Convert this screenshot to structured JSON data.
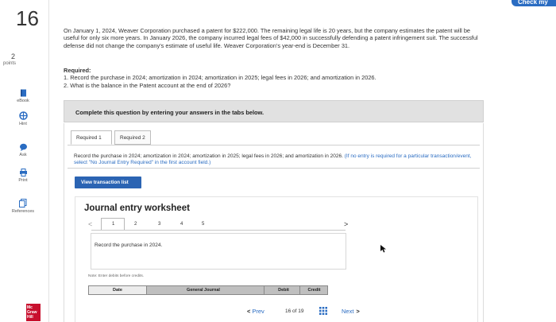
{
  "header": {
    "check_label": "Check my"
  },
  "question": {
    "number": "16",
    "points_value": "2",
    "points_label": "points"
  },
  "tools": [
    {
      "label": "eBook",
      "icon": "book-icon"
    },
    {
      "label": "Hint",
      "icon": "hint-icon"
    },
    {
      "label": "Ask",
      "icon": "ask-icon"
    },
    {
      "label": "Print",
      "icon": "print-icon"
    },
    {
      "label": "References",
      "icon": "references-icon"
    }
  ],
  "publisher_logo": "Mc Graw Hill",
  "problem": {
    "text": "On January 1, 2024, Weaver Corporation purchased a patent for $222,000. The remaining legal life is 20 years, but the company estimates the patent will be useful for only six more years. In January 2026, the company incurred legal fees of $42,000 in successfully defending a patent infringement suit. The successful defense did not change the company's estimate of useful life. Weaver Corporation's year-end is December 31.",
    "required_heading": "Required:",
    "required_1": "1. Record the purchase in 2024; amortization in 2024; amortization in 2025; legal fees in 2026; and amortization in 2026.",
    "required_2": "2. What is the balance in the Patent account at the end of 2026?"
  },
  "instruction_band": "Complete this question by entering your answers in the tabs below.",
  "tabs": [
    {
      "label": "Required 1"
    },
    {
      "label": "Required 2"
    }
  ],
  "tab_instruction": {
    "main": "Record the purchase in 2024; amortization in 2024; amortization in 2025; legal fees in 2026; and amortization in 2026.",
    "note": "(If no entry is required for a particular transaction/event, select \"No Journal Entry Required\" in the first account field.)"
  },
  "view_button": "View transaction list",
  "worksheet": {
    "title": "Journal entry worksheet",
    "pages": [
      "1",
      "2",
      "3",
      "4",
      "5"
    ],
    "prev_symbol": "<",
    "next_symbol": ">",
    "record_text": "Record the purchase in 2024.",
    "note": "Note: Enter debits before credits.",
    "columns": {
      "date": "Date",
      "general_journal": "General Journal",
      "debit": "Debit",
      "credit": "Credit"
    }
  },
  "navigation": {
    "prev": "Prev",
    "page_text": "16 of 19",
    "next": "Next"
  },
  "colors": {
    "accent": "#2a6cc2",
    "button": "#2b64b3",
    "band": "#e1e1e1",
    "logo": "#c8102e"
  }
}
